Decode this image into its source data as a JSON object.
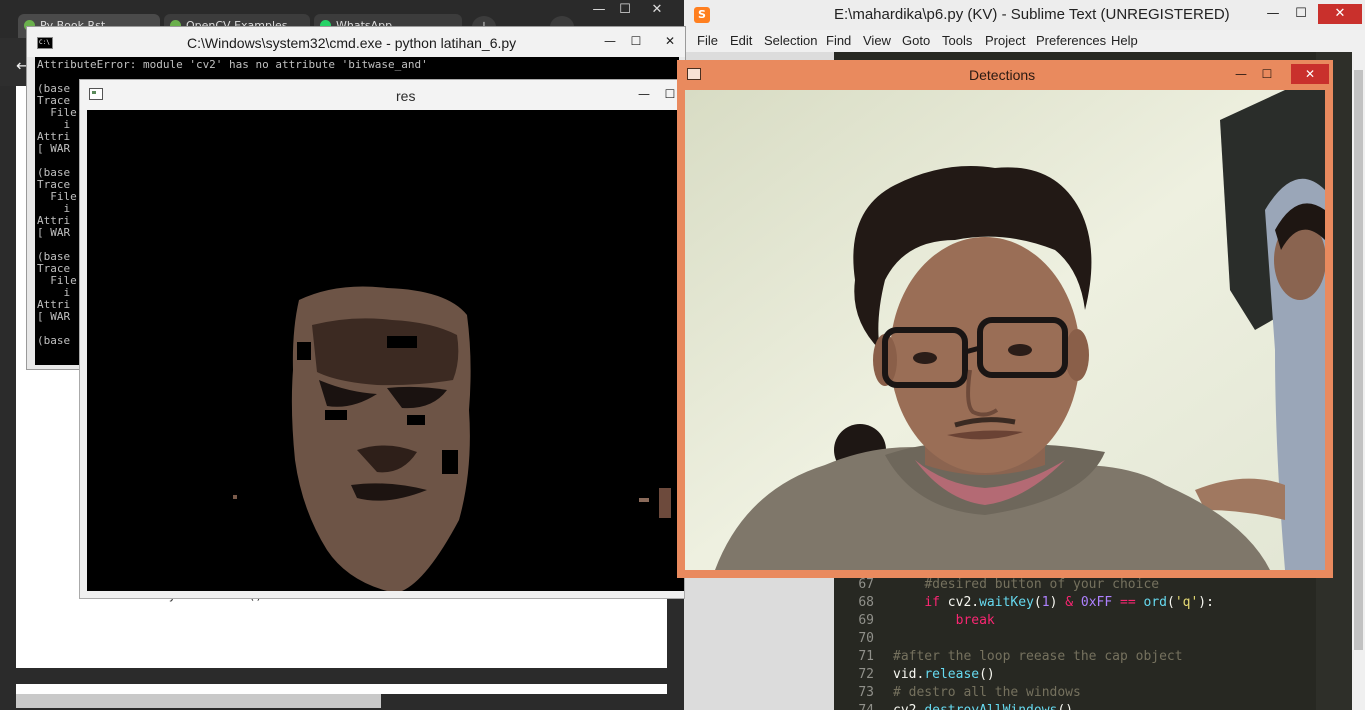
{
  "browser": {
    "tabs": [
      {
        "label": "Py Book Rst"
      },
      {
        "label": "OpenCV Examples"
      },
      {
        "label": "WhatsApp"
      }
    ],
    "new_tab": "+",
    "back": "←",
    "code_peek": "# cv2.destroyAllWindows()",
    "controls": {
      "minimize": "—",
      "maximize": "☐",
      "close": "✕"
    }
  },
  "cmd": {
    "title": "C:\\Windows\\system32\\cmd.exe - python  latihan_6.py",
    "icon_text": "C:\\",
    "controls": {
      "minimize": "—",
      "maximize": "☐",
      "close": "✕"
    },
    "lines": [
      "AttributeError: module 'cv2' has no attribute 'bitwase_and'",
      "",
      "(base",
      "Trace",
      "  File",
      "    i",
      "Attri",
      "[ WAR",
      "",
      "(base",
      "Trace",
      "  File",
      "    i",
      "Attri",
      "[ WAR",
      "",
      "(base",
      "Trace",
      "  File",
      "    i",
      "Attri",
      "[ WAR",
      "",
      "(base"
    ]
  },
  "res": {
    "title": "res",
    "controls": {
      "minimize": "—",
      "maximize": "☐"
    }
  },
  "sublime": {
    "title": "E:\\mahardika\\p6.py (KV) - Sublime Text (UNREGISTERED)",
    "icon_text": "S",
    "controls": {
      "minimize": "—",
      "maximize": "☐",
      "close": "✕"
    },
    "menu": [
      "File",
      "Edit",
      "Selection",
      "Find",
      "View",
      "Goto",
      "Tools",
      "Project",
      "Preferences",
      "Help"
    ],
    "code": [
      {
        "n": "67",
        "indent": "    ",
        "parts": [
          {
            "t": "#desired button of your choice",
            "c": "com"
          }
        ]
      },
      {
        "n": "68",
        "indent": "    ",
        "parts": [
          {
            "t": "if",
            "c": "kw"
          },
          {
            "t": " cv2.",
            "c": ""
          },
          {
            "t": "waitKey",
            "c": "fn"
          },
          {
            "t": "(",
            "c": ""
          },
          {
            "t": "1",
            "c": "num"
          },
          {
            "t": ") ",
            "c": ""
          },
          {
            "t": "&",
            "c": "kw"
          },
          {
            "t": " ",
            "c": ""
          },
          {
            "t": "0xFF",
            "c": "num"
          },
          {
            "t": " ",
            "c": ""
          },
          {
            "t": "==",
            "c": "kw"
          },
          {
            "t": " ",
            "c": ""
          },
          {
            "t": "ord",
            "c": "fn"
          },
          {
            "t": "(",
            "c": ""
          },
          {
            "t": "'q'",
            "c": "str"
          },
          {
            "t": "):",
            "c": ""
          }
        ]
      },
      {
        "n": "69",
        "indent": "        ",
        "parts": [
          {
            "t": "break",
            "c": "kw"
          }
        ]
      },
      {
        "n": "70",
        "indent": "",
        "parts": []
      },
      {
        "n": "71",
        "indent": "",
        "parts": [
          {
            "t": "#after the loop reease the cap object",
            "c": "com"
          }
        ]
      },
      {
        "n": "72",
        "indent": "",
        "parts": [
          {
            "t": "vid.",
            "c": ""
          },
          {
            "t": "release",
            "c": "fn"
          },
          {
            "t": "()",
            "c": ""
          }
        ]
      },
      {
        "n": "73",
        "indent": "",
        "parts": [
          {
            "t": "# destro all the windows",
            "c": "com"
          }
        ]
      },
      {
        "n": "74",
        "indent": "",
        "parts": [
          {
            "t": "cv2.",
            "c": ""
          },
          {
            "t": "destroyAllWindows",
            "c": "fn"
          },
          {
            "t": "()",
            "c": ""
          }
        ]
      }
    ]
  },
  "detections": {
    "title": "Detections",
    "controls": {
      "minimize": "—",
      "maximize": "☐",
      "close": "✕"
    }
  },
  "colors": {
    "sublime_bg": "#272822",
    "detections_frame": "#e98a5e",
    "close_red": "#c9302c"
  }
}
